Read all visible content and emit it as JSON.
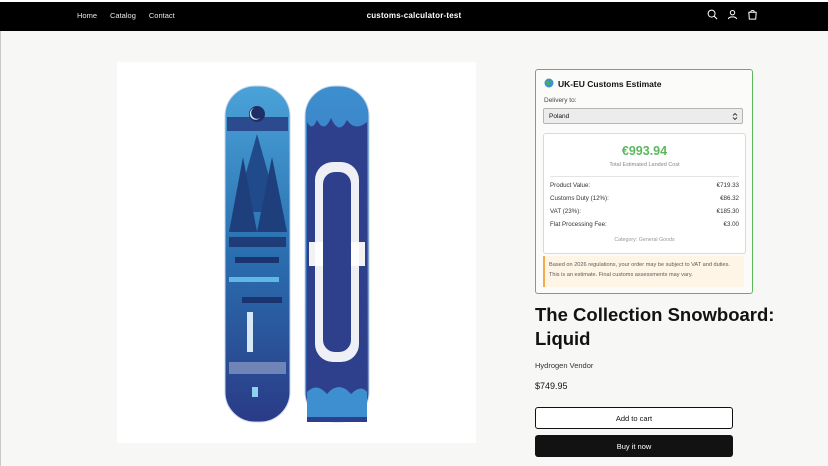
{
  "header": {
    "site_title": "customs-calculator-test",
    "nav": [
      "Home",
      "Catalog",
      "Contact"
    ],
    "icons": [
      "search-icon",
      "account-icon",
      "cart-icon"
    ]
  },
  "widget": {
    "title": "UK-EU Customs Estimate",
    "globe_icon": "globe-icon",
    "delivery_label": "Delivery to:",
    "country": "Poland",
    "total": "€993.94",
    "total_label": "Total Estimated Landed Cost",
    "rows": [
      {
        "label": "Product Value:",
        "value": "€719.33"
      },
      {
        "label": "Customs Duty (12%):",
        "value": "€86.32"
      },
      {
        "label": "VAT (23%):",
        "value": "€185.30"
      },
      {
        "label": "Flat Processing Fee:",
        "value": "€3.00"
      }
    ],
    "category": "Category: General Goods",
    "note_line1": "Based on 2026 regulations, your order may be subject to VAT and duties.",
    "note_line2": "This is an estimate. Final customs assessments may vary.",
    "accent_color": "#5cb85c",
    "note_color": "#f0ad4e"
  },
  "product": {
    "title": "The Collection Snowboard: Liquid",
    "vendor": "Hydrogen Vendor",
    "price": "$749.95",
    "add_to_cart": "Add to cart",
    "buy_now": "Buy it now"
  }
}
